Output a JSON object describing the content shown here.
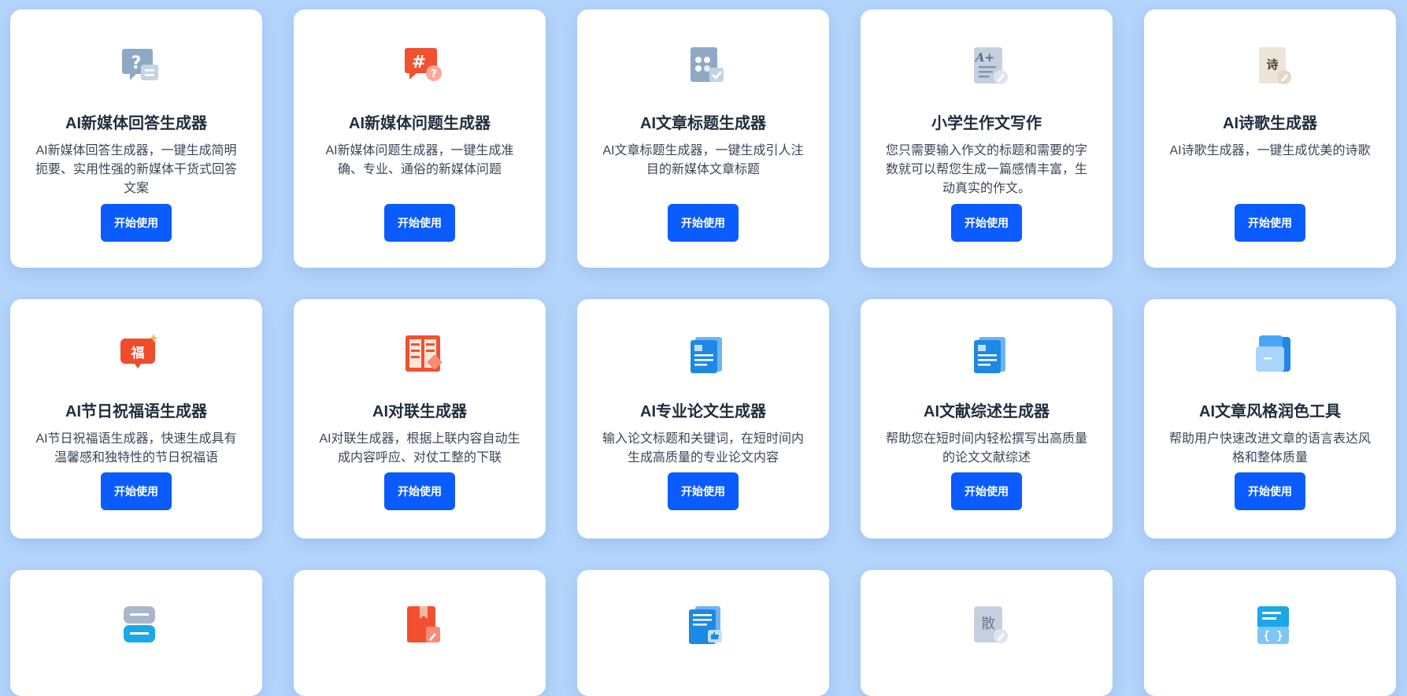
{
  "action_label": "开始使用",
  "accent_color": "#0a5cff",
  "cards": [
    {
      "title": "AI新媒体回答生成器",
      "desc": "AI新媒体回答生成器，一键生成简明扼要、实用性强的新媒体干货式回答文案",
      "icon": "question-chat-icon"
    },
    {
      "title": "AI新媒体问题生成器",
      "desc": "AI新媒体问题生成器，一键生成准确、专业、通俗的新媒体问题",
      "icon": "hashtag-question-icon"
    },
    {
      "title": "AI文章标题生成器",
      "desc": "AI文章标题生成器，一键生成引人注目的新媒体文章标题",
      "icon": "title-grid-check-icon"
    },
    {
      "title": "小学生作文写作",
      "desc": "您只需要输入作文的标题和需要的字数就可以帮您生成一篇感情丰富，生动真实的作文。",
      "icon": "a-plus-document-icon"
    },
    {
      "title": "AI诗歌生成器",
      "desc": "AI诗歌生成器，一键生成优美的诗歌",
      "icon": "poem-scroll-icon"
    },
    {
      "title": "AI节日祝福语生成器",
      "desc": "AI节日祝福语生成器，快速生成具有温馨感和独特性的节日祝福语",
      "icon": "fu-blessing-icon"
    },
    {
      "title": "AI对联生成器",
      "desc": "AI对联生成器，根据上联内容自动生成内容呼应、对仗工整的下联",
      "icon": "couplet-book-icon"
    },
    {
      "title": "AI专业论文生成器",
      "desc": "输入论文标题和关键词，在短时间内生成高质量的专业论文内容",
      "icon": "paper-document-icon"
    },
    {
      "title": "AI文献综述生成器",
      "desc": "帮助您在短时间内轻松撰写出高质量的论文文献综述",
      "icon": "literature-document-icon"
    },
    {
      "title": "AI文章风格润色工具",
      "desc": "帮助用户快速改进文章的语言表达风格和整体质量",
      "icon": "folder-polish-icon"
    },
    {
      "title": "",
      "desc": "",
      "icon": "stacked-cards-icon"
    },
    {
      "title": "",
      "desc": "",
      "icon": "red-book-edit-icon"
    },
    {
      "title": "",
      "desc": "",
      "icon": "document-thumbs-up-icon"
    },
    {
      "title": "",
      "desc": "",
      "icon": "prose-document-icon"
    },
    {
      "title": "",
      "desc": "",
      "icon": "code-braces-icon"
    }
  ]
}
